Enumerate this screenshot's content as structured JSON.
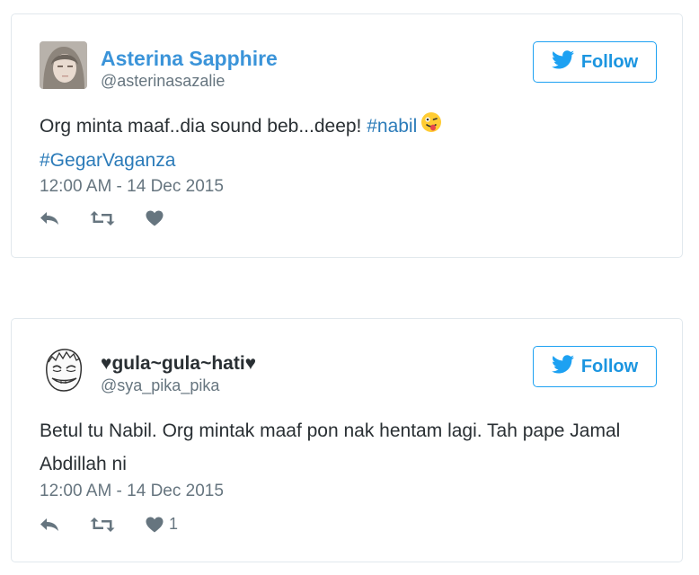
{
  "tweets": [
    {
      "display_name": "Asterina Sapphire",
      "handle": "@asterinasazalie",
      "follow_label": "Follow",
      "text_before": "Org minta maaf..dia sound beb...deep! ",
      "hashtag1": "#nabil",
      "hashtag2": "#GegarVaganza",
      "emoji_name": "winking-face-with-tongue-emoji",
      "timestamp": "12:00 AM - 14 Dec 2015",
      "like_count": ""
    },
    {
      "display_name": "♥gula~gula~hati♥",
      "handle": "@sya_pika_pika",
      "follow_label": "Follow",
      "text": "Betul tu Nabil. Org mintak maaf pon nak hentam lagi. Tah pape Jamal Abdillah ni",
      "timestamp": "12:00 AM - 14 Dec 2015",
      "like_count": "1"
    }
  ],
  "icons": {
    "reply": "reply-icon",
    "retweet": "retweet-icon",
    "like": "heart-icon",
    "bird": "twitter-bird-icon"
  },
  "colors": {
    "accent": "#1da1f2",
    "link": "#2b7bb9",
    "name_blue": "#3b94d9",
    "muted": "#66757f",
    "text": "#292f33",
    "border": "#e1e8ed"
  }
}
